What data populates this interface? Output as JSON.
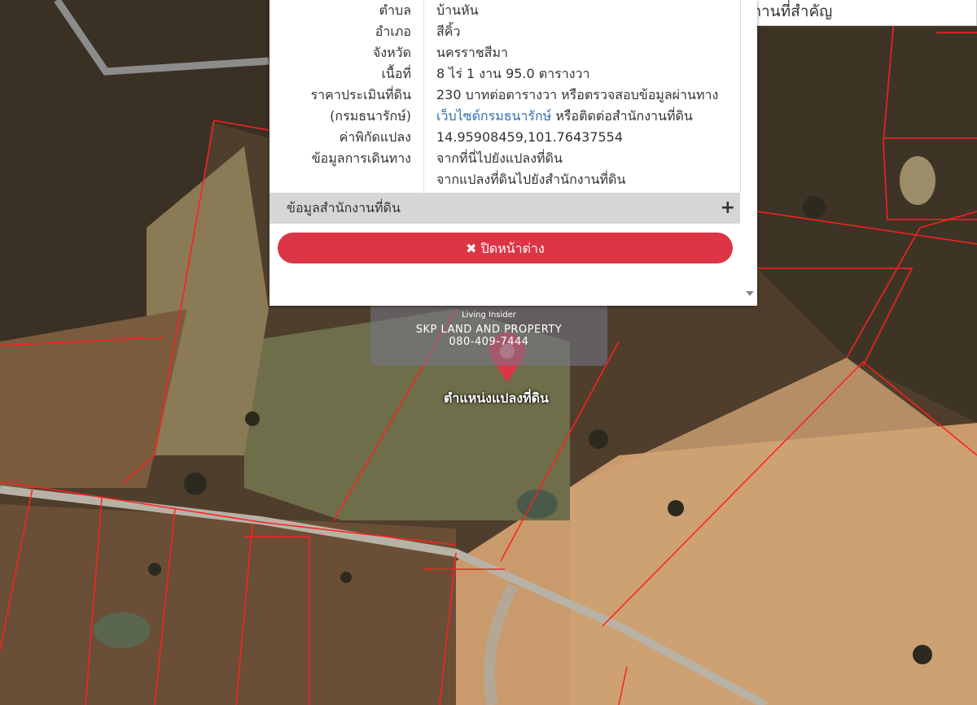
{
  "info": {
    "rows": [
      {
        "label": "ตำบล",
        "value": "บ้านหัน"
      },
      {
        "label": "อำเภอ",
        "value": "สีคิ้ว"
      },
      {
        "label": "จังหวัด",
        "value": "นครราชสีมา"
      },
      {
        "label": "เนื้อที่",
        "value": "8 ไร่ 1 งาน 95.0 ตารางวา"
      },
      {
        "label": "ราคาประเมินที่ดิน",
        "value": "230 บาทต่อตารางวา หรือตรวจสอบข้อมูลผ่านทาง"
      },
      {
        "label": "(กรมธนารักษ์)",
        "value_link": "เว็บไซต์กรมธนารักษ์",
        "value_suffix": " หรือติดต่อสำนักงานที่ดิน"
      },
      {
        "label": "ค่าพิกัดแปลง",
        "value": "14.95908459,101.76437554"
      },
      {
        "label": "ข้อมูลการเดินทาง",
        "value": "จากที่นี่ไปยังแปลงที่ดิน"
      },
      {
        "label": "",
        "value": "จากแปลงที่ดินไปยังสำนักงานที่ดิน"
      }
    ]
  },
  "office_section": {
    "label": "ข้อมูลสำนักงานที่ดิน",
    "expand_icon": "plus-icon"
  },
  "close_button": {
    "icon": "close-x-icon",
    "label": "ปิดหน้าต่าง"
  },
  "search": {
    "text": "ค้นหาสถานที่สำคัญ"
  },
  "watermark": {
    "logo_text": "Living Insider",
    "company": "SKP LAND AND PROPERTY",
    "phone": "080-409-7444"
  },
  "marker": {
    "label": "ตำแหน่งแปลงที่ดิน",
    "color": "#dc3545"
  },
  "colors": {
    "accent": "#dc3545",
    "link": "#2f6fb0",
    "parcel_line": "#ff2020"
  }
}
